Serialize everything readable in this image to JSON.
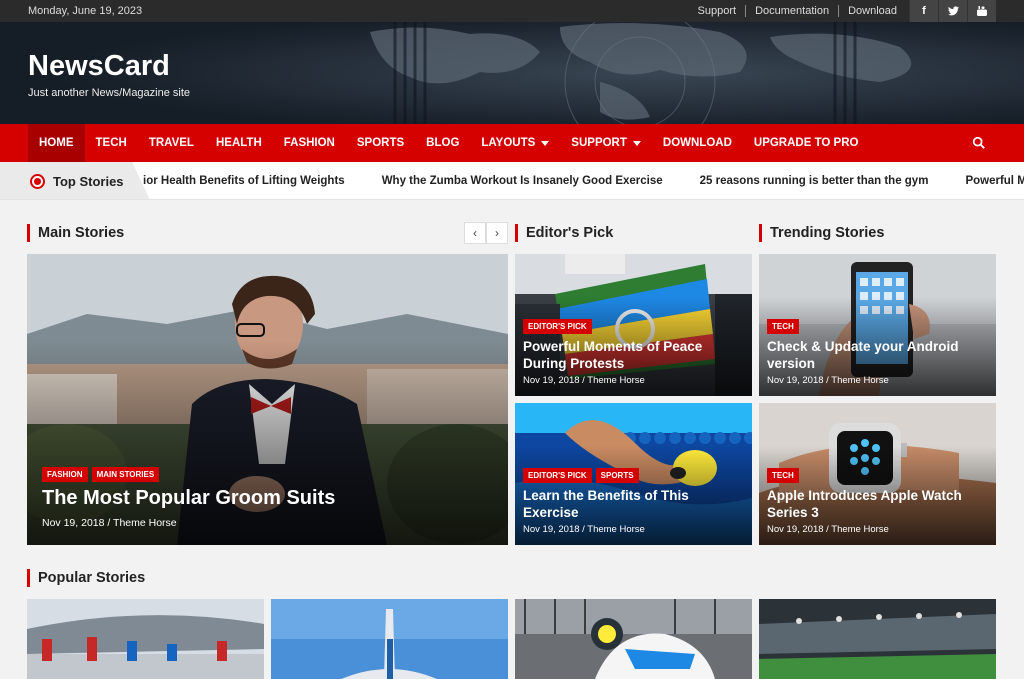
{
  "topbar": {
    "date": "Monday, June 19, 2023",
    "links": [
      "Support",
      "Documentation",
      "Download"
    ],
    "social_icons": [
      "facebook-icon",
      "twitter-icon",
      "youtube-icon"
    ]
  },
  "header": {
    "site_title": "NewsCard",
    "tagline": "Just another News/Magazine site"
  },
  "nav": {
    "items": [
      {
        "label": "HOME",
        "active": true
      },
      {
        "label": "TECH"
      },
      {
        "label": "TRAVEL"
      },
      {
        "label": "HEALTH"
      },
      {
        "label": "FASHION"
      },
      {
        "label": "SPORTS"
      },
      {
        "label": "BLOG"
      },
      {
        "label": "LAYOUTS",
        "dropdown": true
      },
      {
        "label": "SUPPORT",
        "dropdown": true
      },
      {
        "label": "DOWNLOAD"
      },
      {
        "label": "UPGRADE TO PRO"
      }
    ],
    "search_icon": "search-icon"
  },
  "ticker": {
    "label": "Top Stories",
    "items": [
      "ior Health Benefits of Lifting Weights",
      "Why the Zumba Workout Is Insanely Good Exercise",
      "25 reasons running is better than the gym",
      "Powerful Mom"
    ]
  },
  "sections": {
    "main": "Main Stories",
    "editors": "Editor's Pick",
    "trending": "Trending Stories",
    "popular": "Popular Stories"
  },
  "main_story": {
    "tags": [
      "FASHION",
      "MAIN STORIES"
    ],
    "title": "The Most Popular Groom Suits",
    "meta": "Nov 19, 2018 / Theme Horse"
  },
  "editors_pick": [
    {
      "tags": [
        "EDITOR'S PICK"
      ],
      "title": "Powerful Moments of Peace During Protests",
      "meta": "Nov 19, 2018 / Theme Horse"
    },
    {
      "tags": [
        "EDITOR'S PICK",
        "SPORTS"
      ],
      "title": "Learn the Benefits of This Exercise",
      "meta": "Nov 19, 2018 / Theme Horse"
    }
  ],
  "trending": [
    {
      "tags": [
        "TECH"
      ],
      "title": "Check & Update your Android version",
      "meta": "Nov 19, 2018 / Theme Horse"
    },
    {
      "tags": [
        "TECH"
      ],
      "title": "Apple Introduces Apple Watch Series 3",
      "meta": "Nov 19, 2018 / Theme Horse"
    }
  ],
  "colors": {
    "accent": "#d50000",
    "accent_dark": "#a80000",
    "topbar": "#2b2b2b"
  }
}
